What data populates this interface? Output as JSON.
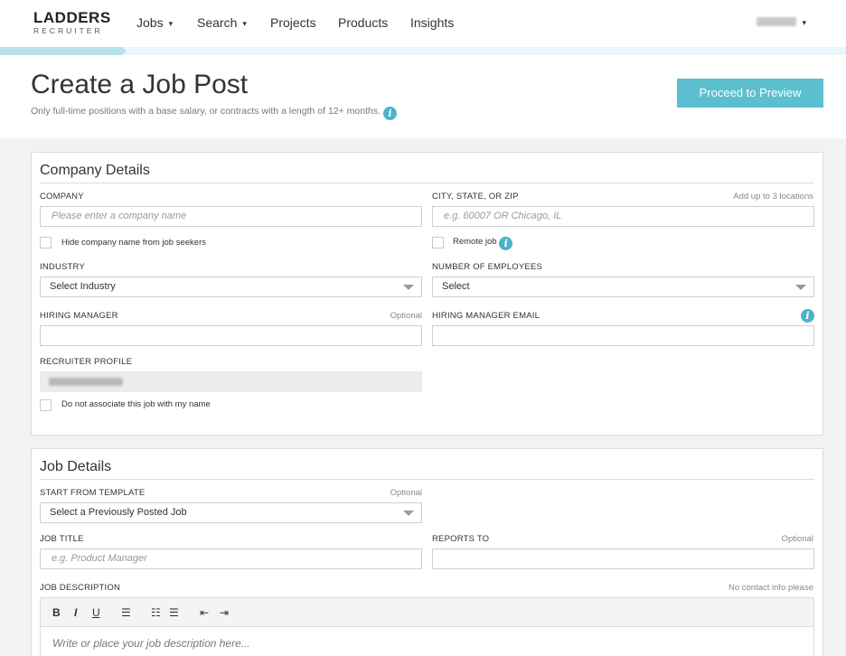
{
  "nav": {
    "logo_main": "LADDERS",
    "logo_sub": "RECRUITER",
    "items": [
      {
        "label": "Jobs",
        "caret": "▾"
      },
      {
        "label": "Search",
        "caret": "▾"
      },
      {
        "label": "Projects"
      },
      {
        "label": "Products"
      },
      {
        "label": "Insights"
      }
    ],
    "user_caret": "▾"
  },
  "progress": {
    "fraction": 0.15
  },
  "header": {
    "title": "Create a Job Post",
    "subtitle": "Only full-time positions with a base salary, or contracts with a length of 12+ months.",
    "proceed_label": "Proceed to Preview"
  },
  "company": {
    "title": "Company Details",
    "company_label": "COMPANY",
    "company_placeholder": "Please enter a company name",
    "hide_company_label": "Hide company name from job seekers",
    "location_label": "CITY, STATE, OR ZIP",
    "location_hint": "Add up to 3 locations",
    "location_placeholder": "e.g. 60007 OR Chicago, IL",
    "remote_label": "Remote job",
    "industry_label": "INDUSTRY",
    "industry_value": "Select Industry",
    "employees_label": "NUMBER OF EMPLOYEES",
    "employees_value": "Select",
    "manager_label": "HIRING MANAGER",
    "manager_hint": "Optional",
    "manager_email_label": "HIRING MANAGER EMAIL",
    "recruiter_label": "RECRUITER PROFILE",
    "no_associate_label": "Do not associate this job with my name"
  },
  "job": {
    "title": "Job Details",
    "template_label": "START FROM TEMPLATE",
    "template_hint": "Optional",
    "template_value": "Select a Previously Posted Job",
    "job_title_label": "JOB TITLE",
    "job_title_placeholder": "e.g. Product Manager",
    "reports_label": "REPORTS TO",
    "reports_hint": "Optional",
    "description_label": "JOB DESCRIPTION",
    "description_hint": "No contact info please",
    "description_placeholder": "Write or place your job description here...",
    "toolbar": {
      "bold": "B",
      "italic": "I",
      "underline": "U",
      "align": "☰",
      "ordered": "☷",
      "unordered": "☰",
      "outdent": "⇤",
      "indent": "⇥"
    }
  },
  "colors": {
    "accent": "#5bbfcf",
    "info": "#4ab3c8"
  },
  "icons": {
    "info": "info-icon",
    "dropdown": "chevron-down-icon"
  }
}
